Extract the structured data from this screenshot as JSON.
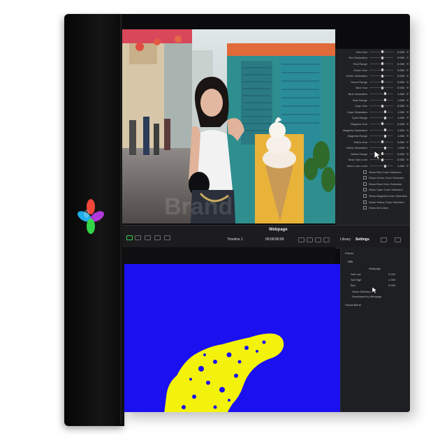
{
  "toolbar": {
    "page_title": "Webpage",
    "timeline_label": "Timeline 1",
    "timecode": "00:00:00:00",
    "tab_library": "Library",
    "tab_settings": "Settings"
  },
  "effect_panel": {
    "params": [
      {
        "label": "Red Hue",
        "value": "0.000",
        "pos": 0.5
      },
      {
        "label": "Red Saturation",
        "value": "0.000",
        "pos": 0.5
      },
      {
        "label": "Red Range",
        "value": "0.000",
        "pos": 0.5
      },
      {
        "label": "Green Hue",
        "value": "0.000",
        "pos": 0.5
      },
      {
        "label": "Green Saturation",
        "value": "0.000",
        "pos": 0.5
      },
      {
        "label": "Green Range",
        "value": "0.000",
        "pos": 0.5
      },
      {
        "label": "Blue Hue",
        "value": "0.000",
        "pos": 0.5
      },
      {
        "label": "Blue Saturation",
        "value": "1.000",
        "pos": 0.62
      },
      {
        "label": "Blue Range",
        "value": "1.000",
        "pos": 0.62
      },
      {
        "label": "Cyan Hue",
        "value": "0.000",
        "pos": 0.5
      },
      {
        "label": "Cyan Saturation",
        "value": "1.000",
        "pos": 0.62
      },
      {
        "label": "Cyan Range",
        "value": "1.000",
        "pos": 0.62
      },
      {
        "label": "Magenta Hue",
        "value": "0.000",
        "pos": 0.5
      },
      {
        "label": "Magenta Saturation",
        "value": "1.000",
        "pos": 0.62
      },
      {
        "label": "Magenta Range",
        "value": "1.000",
        "pos": 0.62
      },
      {
        "label": "Yellow Hue",
        "value": "0.000",
        "pos": 0.5
      },
      {
        "label": "Yellow Saturation",
        "value": "1.000",
        "pos": 0.62
      },
      {
        "label": "Yellow Range",
        "value": "0.000",
        "pos": 0.5
      },
      {
        "label": "Neon Sat Level",
        "value": "0.000",
        "pos": 0.5
      },
      {
        "label": "Neon Lum Level",
        "value": "1.000",
        "pos": 0.62
      }
    ],
    "checkboxes": [
      "Show Red Color Selection",
      "Show Green Color Selection",
      "Show Blue Color Selection",
      "Show Cyan Color Selection",
      "Show Magenta Color Selection",
      "Show Yellow Color Selection",
      "Show All Colors"
    ]
  },
  "inspector": {
    "section": "Effects",
    "fx_name": "HSL",
    "fx_source": "Webpage",
    "row1_label": "Sat Low",
    "row1_value": "0.000",
    "row2_label": "Sat High",
    "row2_value": "1.000",
    "row3_label": "Blur",
    "row3_value": "0.000",
    "check1": "Show Selection",
    "check2": "Developed by Webpage",
    "global_blend": "Global Blend"
  },
  "colors": {
    "matte_blue": "#1a10f0",
    "matte_yellow": "#f2f20a",
    "box_black": "#0b0b0d"
  }
}
